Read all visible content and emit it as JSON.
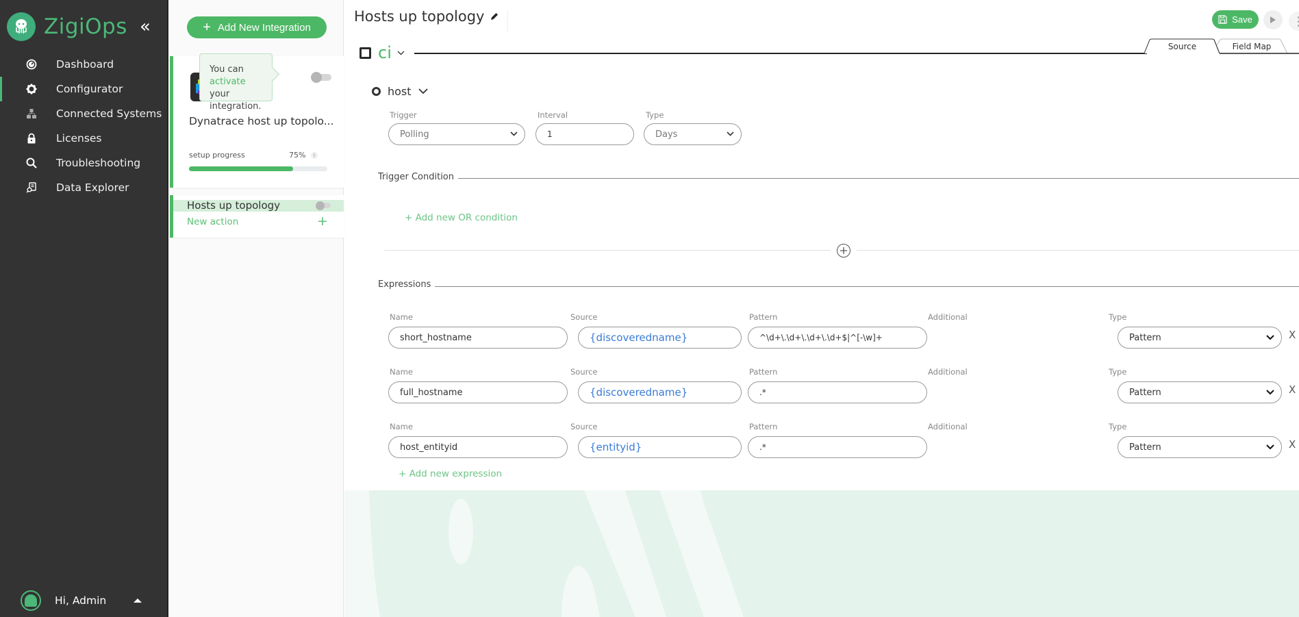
{
  "app": {
    "name": "ZigiOps",
    "collapse_icon": "double-chevron-left-icon"
  },
  "sidebar": {
    "items": [
      {
        "label": "Dashboard",
        "icon": "gauge-icon",
        "active": false
      },
      {
        "label": "Configurator",
        "icon": "gear-icon",
        "active": true
      },
      {
        "label": "Connected Systems",
        "icon": "network-icon",
        "active": false
      },
      {
        "label": "Licenses",
        "icon": "lock-icon",
        "active": false
      },
      {
        "label": "Troubleshooting",
        "icon": "search-icon",
        "active": false
      },
      {
        "label": "Data Explorer",
        "icon": "data-explorer-icon",
        "active": false
      }
    ],
    "user": {
      "greeting": "Hi, Admin"
    }
  },
  "integrations": {
    "add_button": "Add New Integration",
    "card": {
      "name": "Dynatrace host up topolo...",
      "progress_label": "setup progress",
      "progress_text": "75%",
      "progress_value": 0.75,
      "active": false,
      "tooltip": {
        "prefix": "You can ",
        "highlight": "activate",
        "suffix": "your integration."
      }
    },
    "actions": [
      {
        "name": "Hosts up topology",
        "active": false
      }
    ],
    "new_action_label": "New action",
    "new_action_icon": "+"
  },
  "main": {
    "title": "Hosts up topology",
    "save_label": "Save",
    "ci_label": "ci",
    "tabs": [
      {
        "label": "Source",
        "active": true
      },
      {
        "label": "Field Map",
        "active": false
      }
    ],
    "entity": {
      "label": "host"
    },
    "trigger": {
      "trigger_label": "Trigger",
      "trigger_value": "Polling",
      "interval_label": "Interval",
      "interval_value": "1",
      "type_label": "Type",
      "type_value": "Days"
    },
    "trigger_condition": {
      "title": "Trigger Condition",
      "add_or_label": "+ Add new OR condition"
    },
    "expressions": {
      "title": "Expressions",
      "column_labels": {
        "name": "Name",
        "source": "Source",
        "pattern": "Pattern",
        "additional": "Additional",
        "type": "Type"
      },
      "rows": [
        {
          "name": "short_hostname",
          "source": "{discoveredname}",
          "pattern": "^\\d+\\.\\d+\\.\\d+\\.\\d+$|^[-\\w]+",
          "type": "Pattern",
          "remove": "X"
        },
        {
          "name": "full_hostname",
          "source": "{discoveredname}",
          "pattern": ".*",
          "type": "Pattern",
          "remove": "X"
        },
        {
          "name": "host_entityid",
          "source": "{entityid}",
          "pattern": ".*",
          "type": "Pattern",
          "remove": "X"
        }
      ],
      "add_label": "+ Add new expression"
    }
  },
  "colors": {
    "brand_green": "#4cb865",
    "sidebar_bg": "#333333",
    "source_blue": "#3a7bd5",
    "tooltip_bg": "#eff6ef"
  }
}
